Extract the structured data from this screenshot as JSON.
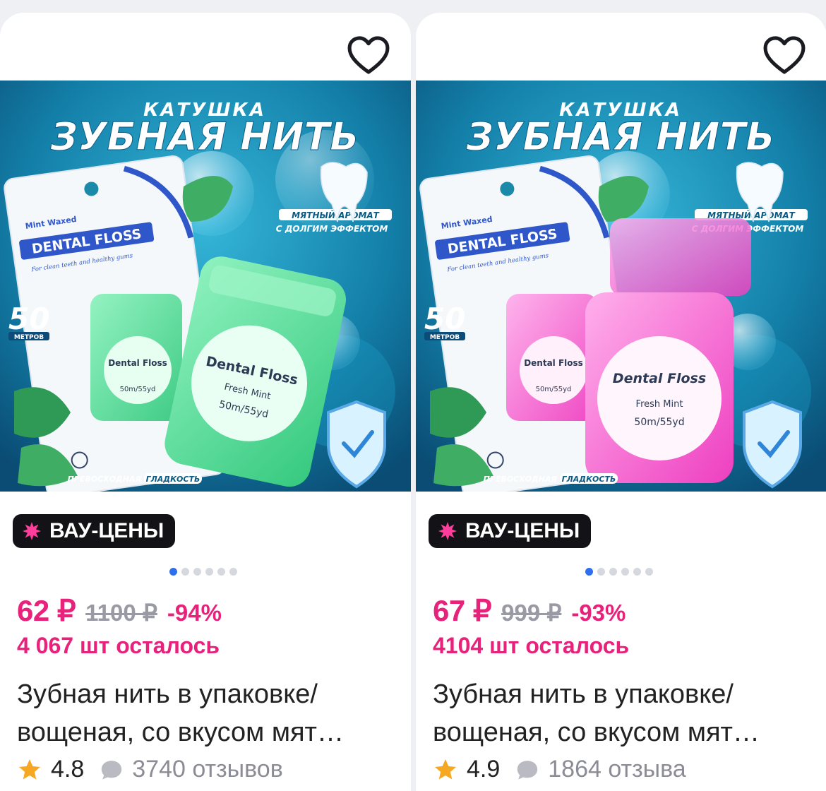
{
  "products": [
    {
      "color_theme": "green",
      "accent_color": "#3fd68a",
      "image_text": {
        "top": "КАТУШКА",
        "headline": "ЗУБНАЯ НИТЬ",
        "aroma_1": "МЯТНЫЙ АРОМАТ",
        "aroma_2": "С ДОЛГИМ ЭФФЕКТОМ",
        "length_num": "50",
        "length_unit": "МЕТРОВ",
        "pack_brand": "DENTAL FLOSS",
        "pack_sub": "For clean teeth and healthy gums",
        "pack_mint": "Mint Waxed",
        "box_brand": "Dental Floss",
        "box_flavor": "Fresh Mint",
        "box_size": "50m/55yd",
        "bottom_1": "ПРЕВОСХОДНАЯ",
        "bottom_2": "ГЛАДКОСТЬ"
      },
      "badge": "ВАУ-ЦЕНЫ",
      "price": "62 ₽",
      "old_price": "1100 ₽",
      "discount": "-94%",
      "stock": "4 067 шт осталось",
      "title": "Зубная нить в упаковке/ вощеная, со вкусом мят…",
      "rating": "4.8",
      "reviews": "3740 отзывов",
      "image_count": 6,
      "active_image": 1
    },
    {
      "color_theme": "pink",
      "accent_color": "#f060c8",
      "image_text": {
        "top": "КАТУШКА",
        "headline": "ЗУБНАЯ НИТЬ",
        "aroma_1": "МЯТНЫЙ АРОМАТ",
        "aroma_2": "С ДОЛГИМ ЭФФЕКТОМ",
        "length_num": "50",
        "length_unit": "МЕТРОВ",
        "pack_brand": "DENTAL FLOSS",
        "pack_sub": "For clean teeth and healthy gums",
        "pack_mint": "Mint Waxed",
        "box_brand": "Dental Floss",
        "box_flavor": "Fresh Mint",
        "box_size": "50m/55yd",
        "bottom_1": "ПРЕВОСХОДНАЯ",
        "bottom_2": "ГЛАДКОСТЬ"
      },
      "badge": "ВАУ-ЦЕНЫ",
      "price": "67 ₽",
      "old_price": "999 ₽",
      "discount": "-93%",
      "stock": "4104 шт осталось",
      "title": "Зубная нить в упаковке/ вощеная, со вкусом мят…",
      "rating": "4.9",
      "reviews": "1864 отзыва",
      "image_count": 6,
      "active_image": 1
    }
  ],
  "icons": {
    "favorite": "heart-outline-icon",
    "badge": "pink-burst-icon",
    "rating": "star-icon",
    "reviews": "speech-bubble-icon"
  },
  "colors": {
    "price_pink": "#e8227b",
    "badge_bg": "#121217",
    "dot_active": "#2f6fed",
    "star": "#f7a822",
    "muted": "#8c8c96"
  }
}
